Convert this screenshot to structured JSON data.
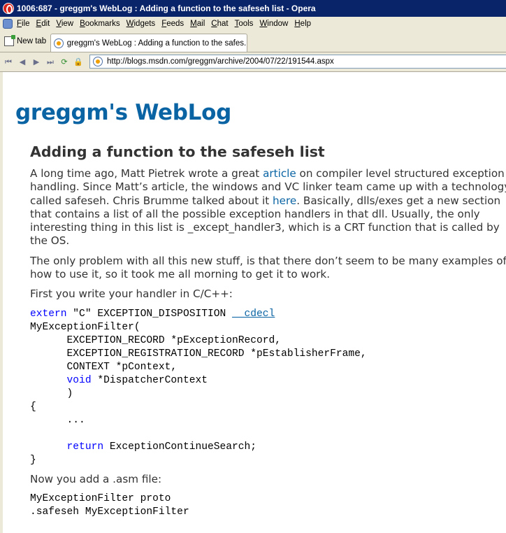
{
  "window": {
    "title": "1006:687 - greggm's WebLog : Adding a function to the safeseh list - Opera"
  },
  "menubar": {
    "items": [
      "File",
      "Edit",
      "View",
      "Bookmarks",
      "Widgets",
      "Feeds",
      "Mail",
      "Chat",
      "Tools",
      "Window",
      "Help"
    ]
  },
  "tabs": {
    "new_tab_label": "New tab",
    "active_tab_label": "greggm's WebLog : Adding a function to the safes..."
  },
  "address_bar": {
    "url": "http://blogs.msdn.com/greggm/archive/2004/07/22/191544.aspx"
  },
  "page": {
    "blog_title": "greggm's WebLog",
    "post_title": "Adding a function to the safeseh list",
    "para1": {
      "part1": "A long time ago, Matt Pietrek wrote a great ",
      "link1": "article",
      "part2": " on compiler level structured exception handling. Since Matt’s article, the windows and VC linker team came up with a technology called safeseh. Chris Brumme talked about it ",
      "link2": "here",
      "part3": ". Basically, dlls/exes get a new section that contains a list of all the possible exception handlers in that dll. Usually, the only interesting thing in this list is _except_handler3, which is a CRT function that is called by the OS."
    },
    "para2": "The only problem with all this new stuff, is that there don’t seem to be many examples of how to use it, so it took me all morning to get it to work.",
    "para3": "First you write your handler in C/C++:",
    "code1": {
      "extern_kw": "extern",
      "decl_rest": " \"C\" EXCEPTION_DISPOSITION ",
      "cdecl_kw": "__cdecl",
      "line2": "MyExceptionFilter(",
      "line3": "      EXCEPTION_RECORD *pExceptionRecord,",
      "line4": "      EXCEPTION_REGISTRATION_RECORD *pEstablisherFrame,",
      "line5": "      CONTEXT *pContext,",
      "line6_indent": "      ",
      "void_kw": "void",
      "line6_rest": " *DispatcherContext",
      "line7": "      )",
      "line8": "{",
      "line9": "      ...",
      "line10": "",
      "line11_indent": "      ",
      "return_kw": "return",
      "line11_rest": " ExceptionContinueSearch;",
      "line12": "}"
    },
    "para4": "Now you add a .asm file:",
    "code2": {
      "line1": "MyExceptionFilter proto",
      "line2": ".safeseh MyExceptionFilter"
    }
  }
}
